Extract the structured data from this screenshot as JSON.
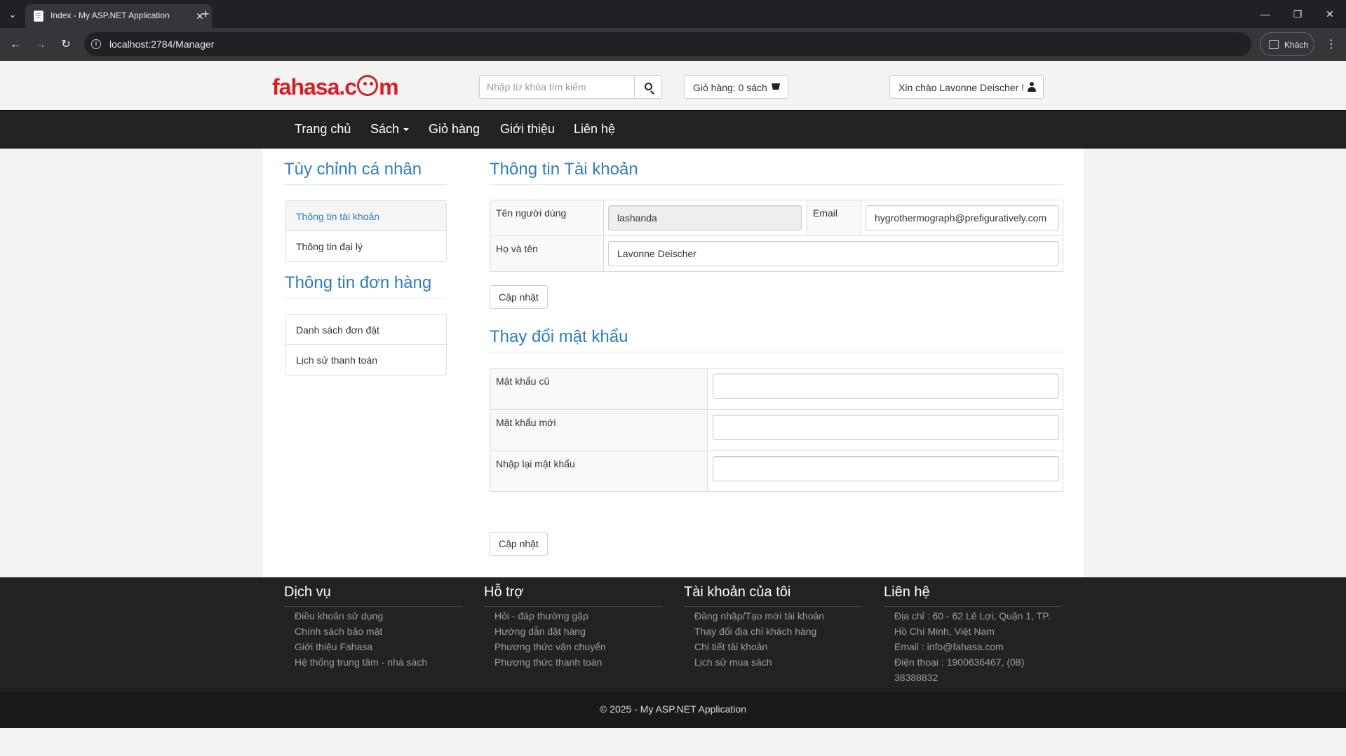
{
  "browser": {
    "tab_title": "Index - My ASP.NET Application",
    "url": "localhost:2784/Manager",
    "guest_label": "Khách"
  },
  "header": {
    "logo": {
      "part1": "fahasa.c",
      "part2": "m"
    },
    "search_placeholder": "Nhập từ khóa tìm kiếm",
    "cart_label": "Giỏ hàng: 0 sách",
    "greeting": "Xin chào Lavonne Deischer !"
  },
  "nav": {
    "home": "Trang chủ",
    "books": "Sách",
    "cart": "Giỏ hàng",
    "about": "Giới thiệu",
    "contact": "Liên hệ"
  },
  "sidebar": {
    "personal_heading": "Tùy chỉnh cá nhân",
    "personal_items": [
      "Thông tin tài khoản",
      "Thông tin đại lý"
    ],
    "orders_heading": "Thông tin đơn hàng",
    "order_items": [
      "Danh sách đơn đặt",
      "Lịch sử thanh toán"
    ]
  },
  "account": {
    "heading": "Thông tin Tài khoản",
    "username_label": "Tên người dùng",
    "username_value": "lashanda",
    "email_label": "Email",
    "email_value": "hygrothermograph@prefiguratively.com",
    "fullname_label": "Họ và tên",
    "fullname_value": "Lavonne Deischer",
    "update_button": "Cập nhật"
  },
  "password": {
    "heading": "Thay đổi mật khẩu",
    "old_label": "Mật khẩu cũ",
    "new_label": "Mật khẩu mới",
    "confirm_label": "Nhập lại mật khẩu",
    "update_button": "Cập nhật"
  },
  "footer": {
    "columns": [
      {
        "heading": "Dịch vụ",
        "links": [
          "Điều khoản sử dụng",
          "Chính sách bảo mật",
          "Giới thiệu Fahasa",
          "Hệ thống trung tâm - nhà sách"
        ]
      },
      {
        "heading": "Hỗ trợ",
        "links": [
          "Hỏi - đáp thường gặp",
          "Hướng dẫn đặt hàng",
          "Phương thức vận chuyển",
          "Phương thức thanh toán"
        ]
      },
      {
        "heading": "Tài khoản của tôi",
        "links": [
          "Đăng nhập/Tạo mới tài khoản",
          "Thay đổi địa chỉ khách hàng",
          "Chi tiết tài khoản",
          "Lịch sử mua sách"
        ]
      },
      {
        "heading": "Liên hệ",
        "links": [
          "Địa chỉ : 60 - 62 Lê Lợi, Quận 1, TP. Hồ Chí Minh, Việt Nam",
          "Email : info@fahasa.com",
          "Điện thoại : 1900636467, (08) 38388832"
        ]
      }
    ],
    "copyright": "© 2025 - My ASP.NET Application"
  },
  "colors": {
    "heading_blue": "#2f7dbe",
    "navbar_bg": "#222222",
    "logo_red": "#d81f26"
  }
}
